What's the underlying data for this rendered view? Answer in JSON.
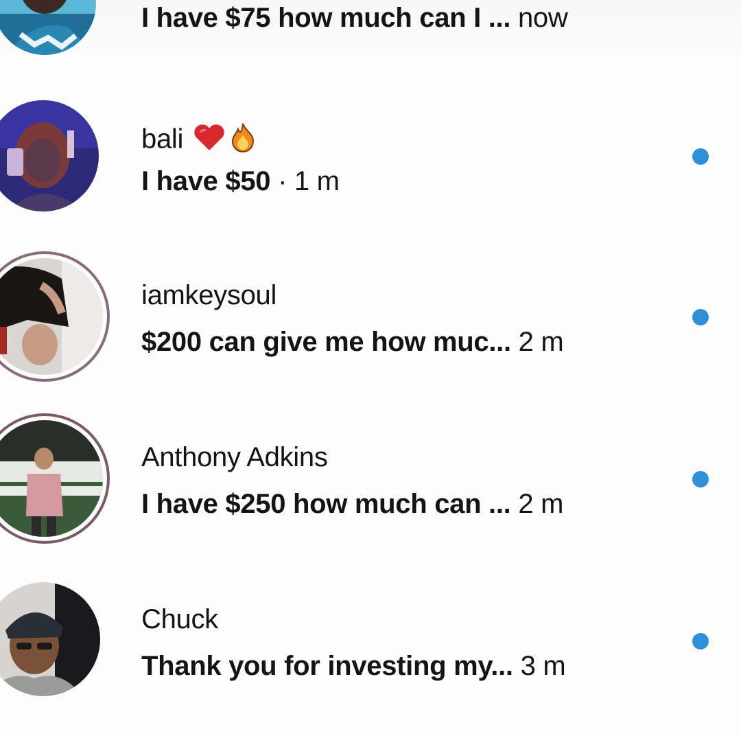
{
  "inbox": {
    "conversations": [
      {
        "name": "",
        "message": "I have $75 how much can I ...",
        "time": "now",
        "unread": false
      },
      {
        "name": "bali",
        "name_emojis": [
          "red-heart-icon",
          "fire-icon"
        ],
        "message": "I have $50",
        "separator": " · ",
        "time": "1 m",
        "unread": true
      },
      {
        "name": "iamkeysoul",
        "message": "$200 can give me how muc...",
        "time": "2 m",
        "unread": true
      },
      {
        "name": "Anthony Adkins",
        "message": "I have $250 how much can ...",
        "time": "2 m",
        "unread": true
      },
      {
        "name": "Chuck",
        "message": "Thank you for investing my...",
        "time": "3 m",
        "unread": true
      }
    ]
  },
  "colors": {
    "unread_dot": "#2f8fd8",
    "text": "#141414",
    "background": "#fdfdfd"
  }
}
